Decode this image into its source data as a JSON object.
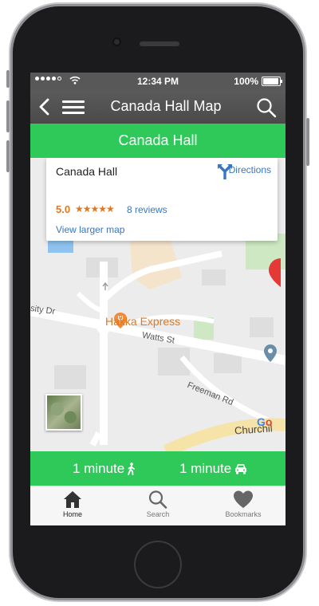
{
  "status_bar": {
    "time": "12:34 PM",
    "battery": "100%"
  },
  "nav": {
    "title": "Canada Hall Map"
  },
  "header": {
    "title": "Canada Hall"
  },
  "info_card": {
    "name": "Canada Hall",
    "rating": "5.0",
    "stars": "★★★★★",
    "reviews": "8 reviews",
    "directions_label": "Directions",
    "larger_map_label": "View larger map"
  },
  "map": {
    "street_sity": "sity Dr",
    "street_watts": "Watts St",
    "street_freeman": "Freeman Rd",
    "street_churchill": "Churchil",
    "poi_hakka": "Hakka Express",
    "google_logo": "Go"
  },
  "travel": {
    "walk_time": "1 minute",
    "drive_time": "1 minute"
  },
  "tabs": [
    {
      "label": "Home",
      "icon": "home-icon"
    },
    {
      "label": "Search",
      "icon": "search-icon"
    },
    {
      "label": "Bookmarks",
      "icon": "heart-icon"
    }
  ],
  "colors": {
    "accent_green": "#2fc95a",
    "link_blue": "#3a75c4",
    "rating_orange": "#e4761b",
    "nav_gray": "#585858"
  }
}
